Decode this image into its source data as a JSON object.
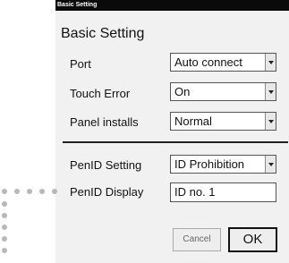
{
  "window": {
    "title": "Basic Setting"
  },
  "heading": "Basic Setting",
  "settings": [
    {
      "label": "Port",
      "value": "Auto connect"
    },
    {
      "label": "Touch Error",
      "value": "On"
    },
    {
      "label": "Panel installs",
      "value": "Normal"
    },
    {
      "label": "PenID Setting",
      "value": "ID Prohibition"
    }
  ],
  "pen_id_display": {
    "label": "PenID Display",
    "value": "ID no. 1"
  },
  "buttons": {
    "cancel": "Cancel",
    "ok": "OK"
  },
  "colors": {
    "titlebar": "#0a0a0a",
    "panel": "#f1f1f1",
    "callout": "#b8b8b8"
  },
  "icons": {
    "dropdown": "chevron-down-icon"
  }
}
